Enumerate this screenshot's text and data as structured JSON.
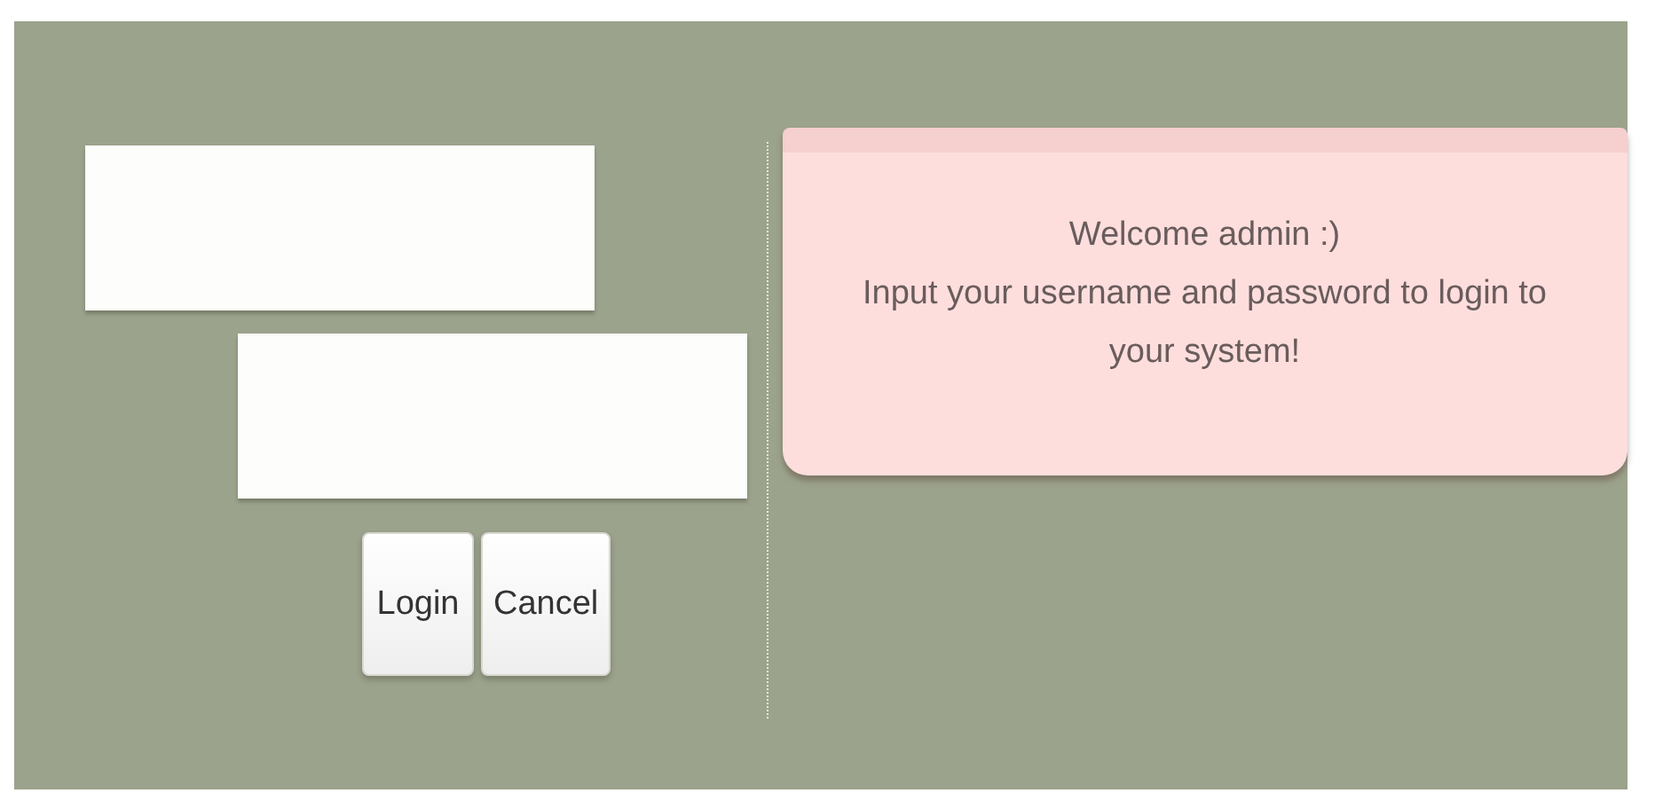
{
  "login_form": {
    "buttons": [
      "Login",
      "Cancel"
    ]
  },
  "message": {
    "title": "Welcome admin :)",
    "body": "Input your username and password to login to your system!"
  }
}
